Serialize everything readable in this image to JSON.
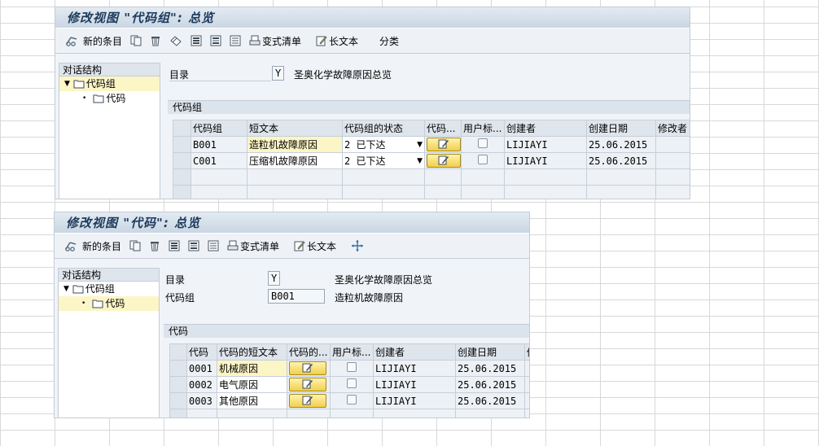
{
  "win1": {
    "title": "修改视图 \"代码组\": 总览",
    "toolbar": {
      "new_entries": "新的条目",
      "variant_list": "变式清单",
      "long_text": "长文本",
      "classify": "分类"
    },
    "nav": {
      "header": "对话结构",
      "items": [
        "代码组",
        "代码"
      ]
    },
    "directory_label": "目录",
    "directory_value": "Y",
    "directory_desc": "圣奥化学故障原因总览",
    "group_title": "代码组",
    "columns": [
      "代码组",
      "短文本",
      "代码组的状态",
      "代码...",
      "用户标...",
      "创建者",
      "创建日期",
      "修改者"
    ],
    "rows": [
      {
        "code": "B001",
        "text": "造粒机故障原因",
        "status": "2 已下达",
        "creator": "LIJIAYI",
        "date": "25.06.2015"
      },
      {
        "code": "C001",
        "text": "压缩机故障原因",
        "status": "2 已下达",
        "creator": "LIJIAYI",
        "date": "25.06.2015"
      }
    ]
  },
  "win2": {
    "title": "修改视图 \"代码\": 总览",
    "toolbar": {
      "new_entries": "新的条目",
      "variant_list": "变式清单",
      "long_text": "长文本"
    },
    "nav": {
      "header": "对话结构",
      "items": [
        "代码组",
        "代码"
      ]
    },
    "directory_label": "目录",
    "directory_value": "Y",
    "directory_desc": "圣奥化学故障原因总览",
    "codegroup_label": "代码组",
    "codegroup_value": "B001",
    "codegroup_desc": "造粒机故障原因",
    "group_title": "代码",
    "columns": [
      "代码",
      "代码的短文本",
      "代码的...",
      "用户标...",
      "创建者",
      "创建日期",
      "修"
    ],
    "rows": [
      {
        "code": "0001",
        "text": "机械原因",
        "creator": "LIJIAYI",
        "date": "25.06.2015"
      },
      {
        "code": "0002",
        "text": "电气原因",
        "creator": "LIJIAYI",
        "date": "25.06.2015"
      },
      {
        "code": "0003",
        "text": "其他原因",
        "creator": "LIJIAYI",
        "date": "25.06.2015"
      }
    ]
  },
  "icons": [
    "glasses-icon",
    "copy-icon",
    "delete-icon",
    "undo-icon",
    "select-all-icon",
    "select-block-icon",
    "deselect-all-icon",
    "print-icon",
    "edit-icon",
    "move-icon",
    "folder-icon",
    "triangle-down-icon",
    "pencil-icon",
    "checkbox-icon"
  ]
}
